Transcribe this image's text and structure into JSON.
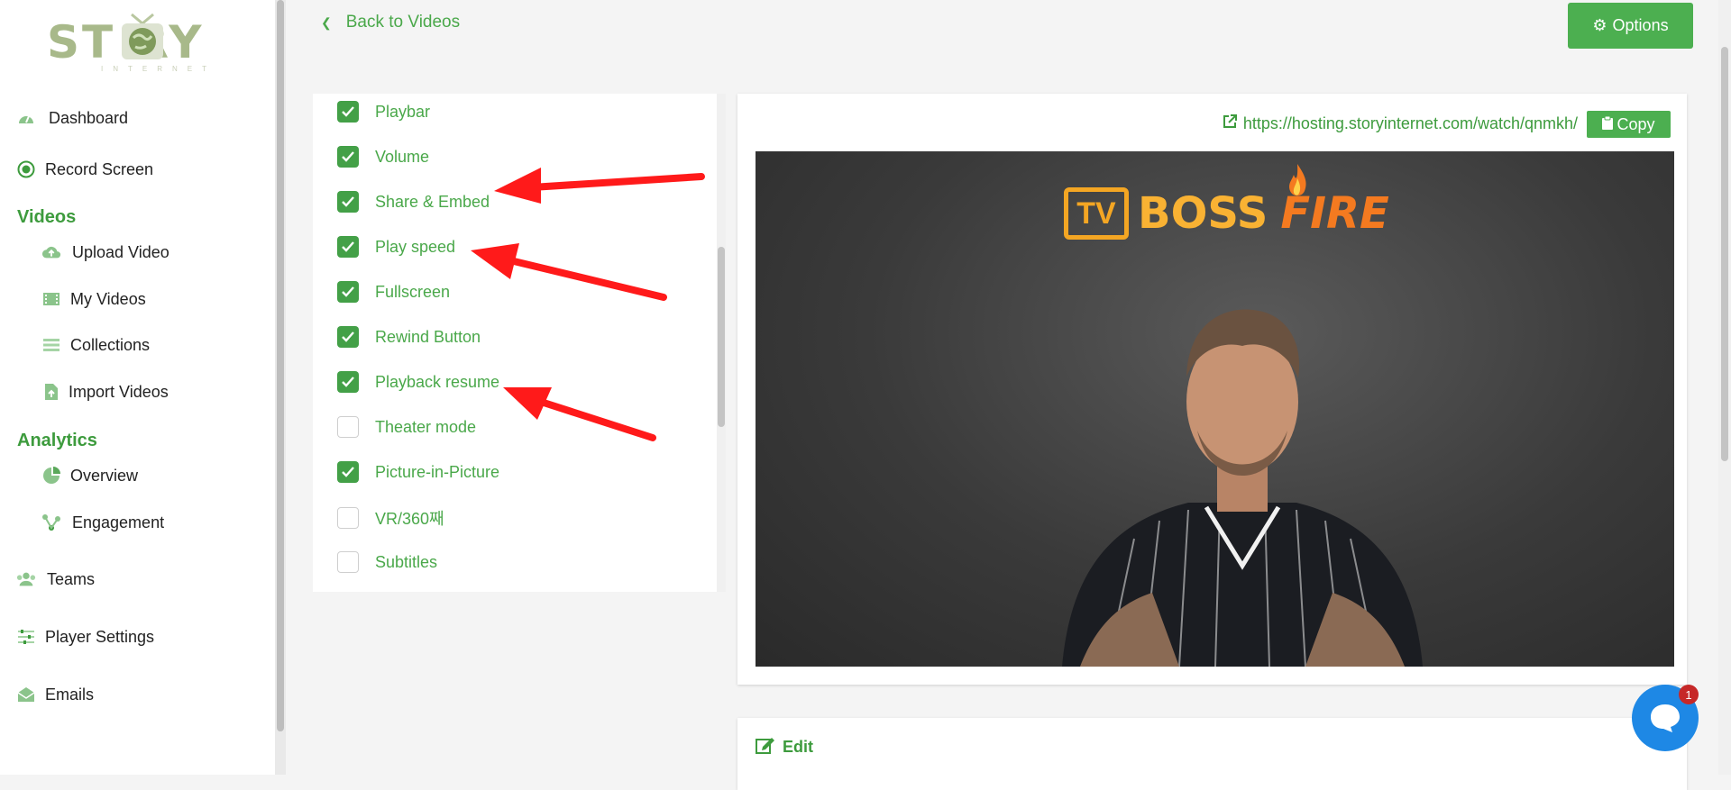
{
  "logo": {
    "text": "ST RY",
    "subtext": "INTERNET"
  },
  "sidebar": {
    "items": [
      {
        "label": "Dashboard",
        "icon": "dashboard-gauge-icon"
      },
      {
        "label": "Record Screen",
        "icon": "record-icon"
      },
      {
        "label": "Videos"
      },
      {
        "label": "Upload Video",
        "icon": "upload-cloud-icon"
      },
      {
        "label": "My Videos",
        "icon": "film-icon"
      },
      {
        "label": "Collections",
        "icon": "list-icon"
      },
      {
        "label": "Import Videos",
        "icon": "import-file-icon"
      },
      {
        "label": "Analytics"
      },
      {
        "label": "Overview",
        "icon": "pie-chart-icon"
      },
      {
        "label": "Engagement",
        "icon": "engagement-icon"
      },
      {
        "label": "Teams",
        "icon": "teams-icon"
      },
      {
        "label": "Player Settings",
        "icon": "sliders-icon"
      },
      {
        "label": "Emails",
        "icon": "envelope-icon"
      }
    ]
  },
  "header": {
    "back_label": "Back to Videos",
    "options_label": "Options"
  },
  "settings": {
    "items": [
      {
        "label": "Playbar",
        "checked": true
      },
      {
        "label": "Volume",
        "checked": true
      },
      {
        "label": "Share & Embed",
        "checked": true
      },
      {
        "label": "Play speed",
        "checked": true
      },
      {
        "label": "Fullscreen",
        "checked": true
      },
      {
        "label": "Rewind Button",
        "checked": true
      },
      {
        "label": "Playback resume",
        "checked": true
      },
      {
        "label": "Theater mode",
        "checked": false
      },
      {
        "label": "Picture-in-Picture",
        "checked": true
      },
      {
        "label": "VR/360째",
        "checked": false
      },
      {
        "label": "Subtitles",
        "checked": false
      }
    ]
  },
  "video": {
    "url": "https://hosting.storyinternet.com/watch/qnmkh/",
    "copy_label": "Copy",
    "logo_tv": "TV",
    "logo_boss": "BOSS",
    "logo_fire": "FIRE"
  },
  "edit": {
    "label": "Edit",
    "title": ""
  },
  "chat": {
    "badge": "1"
  },
  "colors": {
    "accent": "#4caf50",
    "text_green": "#3d9b3d",
    "arrow": "#ff1a1a",
    "chat": "#1e88e5"
  }
}
